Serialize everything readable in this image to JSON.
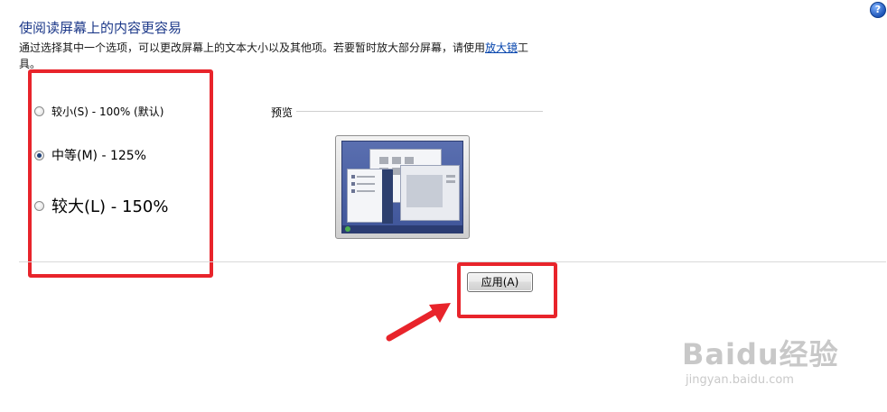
{
  "header": {
    "title": "使阅读屏幕上的内容更容易",
    "description_before": "通过选择其中一个选项，可以更改屏幕上的文本大小以及其他项。若要暂时放大部分屏幕，请使用",
    "description_link": "放大镜",
    "description_after": "工具。",
    "help_icon_label": "?"
  },
  "options": [
    {
      "label": "较小(S) - 100% (默认)",
      "checked": false
    },
    {
      "label": "中等(M) - 125%",
      "checked": true
    },
    {
      "label": "较大(L) - 150%",
      "checked": false
    }
  ],
  "preview": {
    "label": "预览"
  },
  "apply_button": {
    "label": "应用(A)"
  },
  "annotations": {
    "highlight_color": "#e8242b"
  },
  "watermark": {
    "main": "Baidu经验",
    "sub": "jingyan.baidu.com"
  }
}
